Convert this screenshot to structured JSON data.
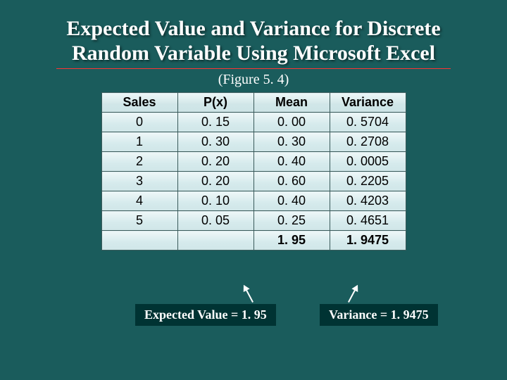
{
  "title": "Expected Value and Variance for Discrete Random Variable Using Microsoft Excel",
  "figure_caption": "(Figure 5. 4)",
  "table": {
    "headers": [
      "Sales",
      "P(x)",
      "Mean",
      "Variance"
    ],
    "rows": [
      [
        "0",
        "0. 15",
        "0. 00",
        "0. 5704"
      ],
      [
        "1",
        "0. 30",
        "0. 30",
        "0. 2708"
      ],
      [
        "2",
        "0. 20",
        "0. 40",
        "0. 0005"
      ],
      [
        "3",
        "0. 20",
        "0. 60",
        "0. 2205"
      ],
      [
        "4",
        "0. 10",
        "0. 40",
        "0. 4203"
      ],
      [
        "5",
        "0. 05",
        "0. 25",
        "0. 4651"
      ]
    ],
    "total": [
      "",
      "",
      "1. 95",
      "1. 9475"
    ]
  },
  "labels": {
    "expected_value": "Expected Value = 1. 95",
    "variance": "Variance = 1. 9475"
  },
  "chart_data": {
    "type": "table",
    "title": "Expected Value and Variance for Discrete Random Variable Using Microsoft Excel",
    "columns": [
      "Sales",
      "P(x)",
      "Mean",
      "Variance"
    ],
    "data": [
      {
        "Sales": 0,
        "P(x)": 0.15,
        "Mean": 0.0,
        "Variance": 0.5704
      },
      {
        "Sales": 1,
        "P(x)": 0.3,
        "Mean": 0.3,
        "Variance": 0.2708
      },
      {
        "Sales": 2,
        "P(x)": 0.2,
        "Mean": 0.4,
        "Variance": 0.0005
      },
      {
        "Sales": 3,
        "P(x)": 0.2,
        "Mean": 0.6,
        "Variance": 0.2205
      },
      {
        "Sales": 4,
        "P(x)": 0.1,
        "Mean": 0.4,
        "Variance": 0.4203
      },
      {
        "Sales": 5,
        "P(x)": 0.05,
        "Mean": 0.25,
        "Variance": 0.4651
      }
    ],
    "totals": {
      "Mean": 1.95,
      "Variance": 1.9475
    },
    "expected_value": 1.95,
    "variance": 1.9475
  }
}
